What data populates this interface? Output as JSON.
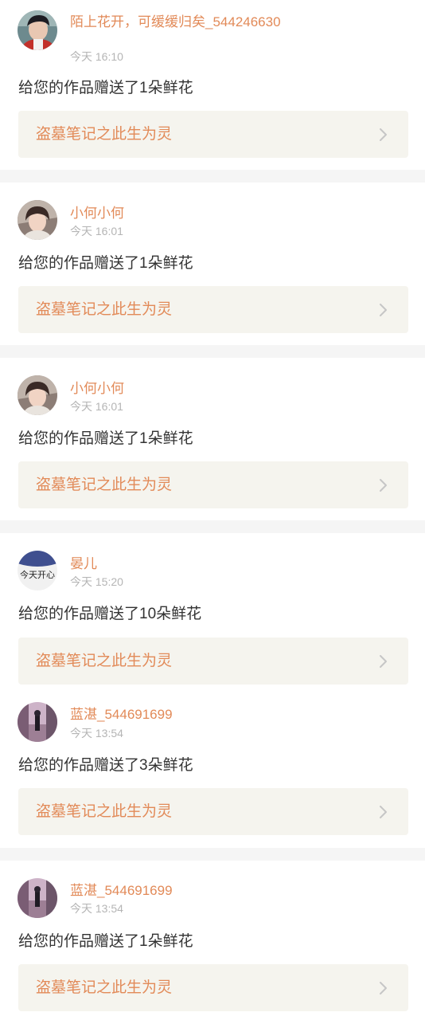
{
  "notifications": [
    {
      "username": "陌上花开，可缓缓归矣_544246630",
      "time": "今天 16:10",
      "message": "给您的作品赠送了1朵鲜花",
      "work_title": "盗墓笔记之此生为灵",
      "avatar": "avatar-young-man-dark-hair"
    },
    {
      "username": "小何小何",
      "time": "今天 16:01",
      "message": "给您的作品赠送了1朵鲜花",
      "work_title": "盗墓笔记之此生为灵",
      "avatar": "avatar-young-woman-short-hair"
    },
    {
      "username": "小何小何",
      "time": "今天 16:01",
      "message": "给您的作品赠送了1朵鲜花",
      "work_title": "盗墓笔记之此生为灵",
      "avatar": "avatar-young-woman-short-hair"
    },
    {
      "username": "晏儿",
      "time": "今天 15:20",
      "message": "给您的作品赠送了10朵鲜花",
      "work_title": "盗墓笔记之此生为灵",
      "avatar": "avatar-handwritten-text-blue-cap",
      "avatar_text": "今天开心"
    },
    {
      "username": "蓝湛_544691699",
      "time": "今天 13:54",
      "message": "给您的作品赠送了3朵鲜花",
      "work_title": "盗墓笔记之此生为灵",
      "avatar": "avatar-figure-city-street"
    },
    {
      "username": "蓝湛_544691699",
      "time": "今天 13:54",
      "message": "给您的作品赠送了1朵鲜花",
      "work_title": "盗墓笔记之此生为灵",
      "avatar": "avatar-figure-city-street"
    }
  ],
  "colors": {
    "accent": "#e28a58",
    "timestamp": "#b5b5b5",
    "message_text": "#333333",
    "link_background": "#f5f4ee",
    "separator": "#f5f5f5"
  },
  "icons": {
    "link_arrow": "chevron-right-icon"
  }
}
